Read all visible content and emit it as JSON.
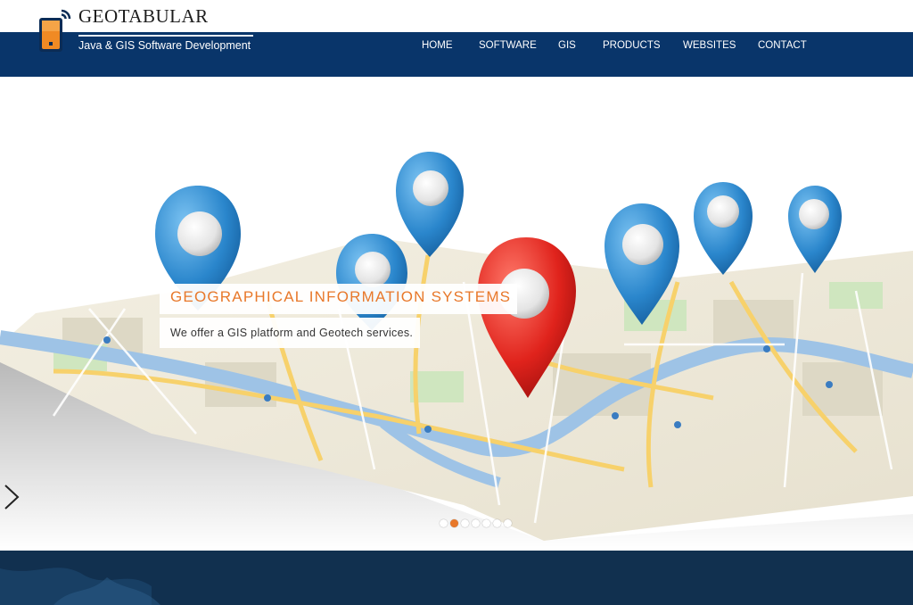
{
  "header": {
    "brand": "GEOTABULAR",
    "tagline": "Java & GIS Software Development",
    "logo_icon": "mobile-signal-icon",
    "brand_color": "#09356a"
  },
  "nav": {
    "items": [
      {
        "label": "HOME"
      },
      {
        "label": "SOFTWARE"
      },
      {
        "label": "GIS"
      },
      {
        "label": "PRODUCTS"
      },
      {
        "label": "WEBSITES"
      },
      {
        "label": "CONTACT"
      }
    ]
  },
  "slider": {
    "title": "GEOGRAPHICAL INFORMATION SYSTEMS",
    "subtitle": "We offer a GIS platform and Geotech services.",
    "slide_count": 7,
    "active_slide": 2,
    "accent_color": "#e8782a",
    "next_icon": "chevron-right-icon"
  }
}
